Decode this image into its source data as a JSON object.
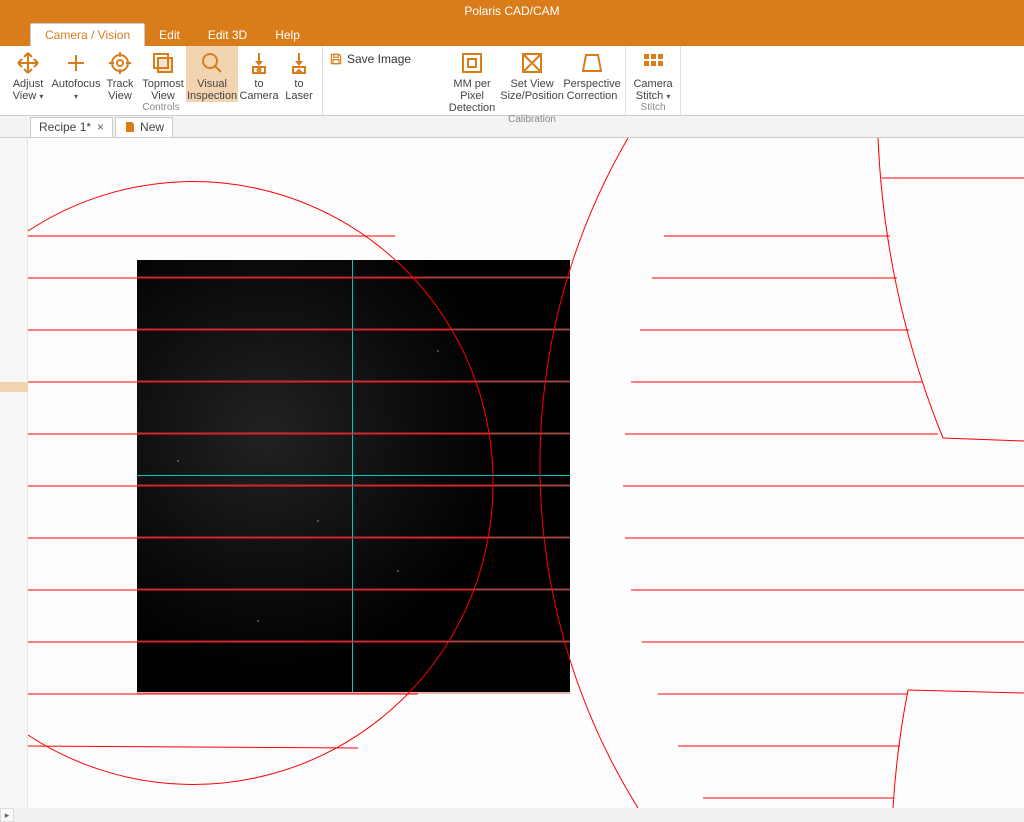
{
  "app": {
    "title": "Polaris CAD/CAM"
  },
  "menu": {
    "tabs": [
      {
        "label": "Camera / Vision",
        "active": true
      },
      {
        "label": "Edit"
      },
      {
        "label": "Edit 3D"
      },
      {
        "label": "Help"
      }
    ]
  },
  "ribbon": {
    "adjust_view": "Adjust View",
    "autofocus": "Autofocus",
    "track_view": "Track View",
    "topmost_view": "Topmost View",
    "visual_inspection": "Visual Inspection",
    "to_camera": "to Camera",
    "to_laser": "to Laser",
    "save_image": "Save Image",
    "mm_per_pixel": "MM per Pixel Detection",
    "set_view_size": "Set View Size/Position",
    "perspective_correction": "Perspective Correction",
    "camera_stitch": "Camera Stitch",
    "group_controls": "Controls",
    "group_calibration": "Calibration",
    "group_stitch": "Stitch"
  },
  "documents": {
    "tabs": [
      {
        "label": "Recipe 1*",
        "closeable": true
      },
      {
        "label": "New",
        "closeable": false
      }
    ]
  },
  "colors": {
    "accent": "#d97d1b",
    "vector": "#ff0000",
    "crosshair": "#00c8c8"
  }
}
